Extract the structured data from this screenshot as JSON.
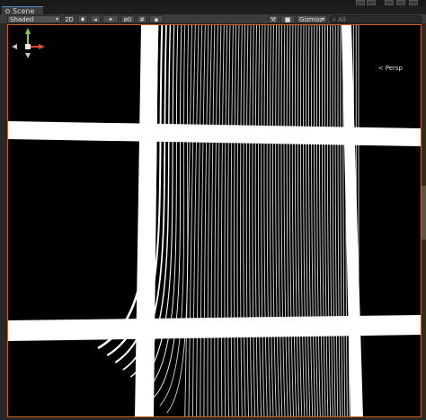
{
  "tab": {
    "label": "Scene"
  },
  "toolbar": {
    "shading_mode": "Shaded",
    "mode_2d": "2D",
    "hidden_count": "0",
    "gizmos_label": "Gizmos",
    "search_placeholder": "All"
  },
  "scene_gizmo": {
    "projection_label": "< Persp"
  },
  "colors": {
    "background": "#000000",
    "lines": "#ffffff",
    "viewport_border": "#d06020",
    "tab_accent": "#4a88d8"
  }
}
